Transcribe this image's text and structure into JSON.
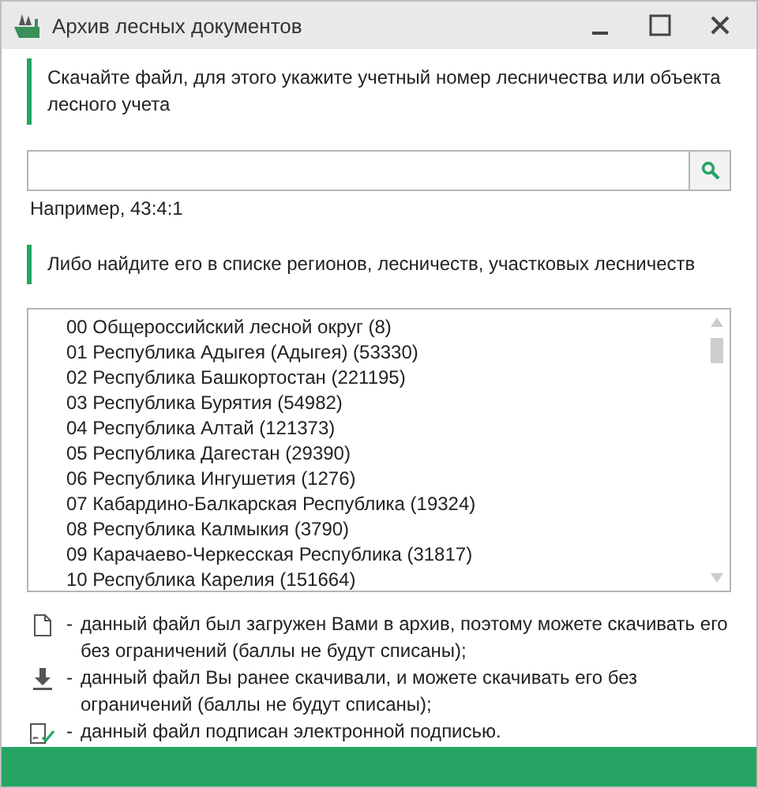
{
  "window": {
    "title": "Архив лесных документов"
  },
  "notes": [
    "Скачайте файл, для этого укажите учетный номер лесничества или объекта лесного учета",
    "Либо найдите его в списке регионов, лесничеств, участковых лесничеств"
  ],
  "search": {
    "hint": "Например, 43:4:1"
  },
  "list": {
    "items": [
      {
        "label": "00 Общероссийский лесной округ (8)"
      },
      {
        "label": "01 Республика Адыгея (Адыгея) (53330)"
      },
      {
        "label": "02 Республика Башкортостан (221195)"
      },
      {
        "label": "03 Республика Бурятия (54982)"
      },
      {
        "label": "04 Республика Алтай (121373)"
      },
      {
        "label": "05 Республика Дагестан (29390)"
      },
      {
        "label": "06 Республика Ингушетия (1276)"
      },
      {
        "label": "07 Кабардино-Балкарская Республика (19324)"
      },
      {
        "label": "08 Республика Калмыкия (3790)"
      },
      {
        "label": "09 Карачаево-Черкесская Республика (31817)"
      },
      {
        "label": "10 Республика Карелия (151664)"
      }
    ]
  },
  "legend": [
    {
      "kind": "file",
      "dash": "-",
      "text": "данный файл был загружен Вами в архив, поэтому можете скачивать его без ограничений (баллы не будут списаны);"
    },
    {
      "kind": "download",
      "dash": "-",
      "text": "данный файл Вы ранее скачивали, и можете скачивать его без ограничений (баллы не будут списаны);"
    },
    {
      "kind": "signed",
      "dash": "-",
      "text": "данный файл подписан электронной подписью."
    }
  ]
}
